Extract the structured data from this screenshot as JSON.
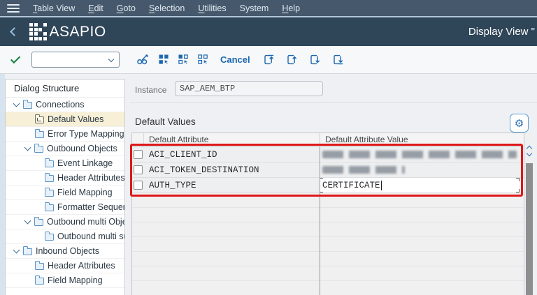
{
  "menu_bar": {
    "items": [
      {
        "label": "Table View",
        "accel": "T"
      },
      {
        "label": "Edit",
        "accel": "E"
      },
      {
        "label": "Goto",
        "accel": "G"
      },
      {
        "label": "Selection",
        "accel": "S"
      },
      {
        "label": "Utilities",
        "accel": "U"
      },
      {
        "label": "System",
        "accel": null
      },
      {
        "label": "Help",
        "accel": "H"
      }
    ]
  },
  "title_bar": {
    "logo_text": "ASAPIO",
    "window_title": "Display View \""
  },
  "toolbar": {
    "command_field_value": "",
    "cancel_label": "Cancel",
    "icon_names": [
      "enter-check-icon",
      "command-combobox",
      "display-change-icon",
      "select-all-icon",
      "select-block-icon",
      "deselect-all-icon",
      "first-page-icon",
      "previous-page-icon",
      "next-page-icon",
      "last-page-icon"
    ]
  },
  "sidebar": {
    "header": "Dialog Structure",
    "items": [
      {
        "label": "Connections",
        "indent": 10,
        "chevron": true,
        "icon": "folder-open",
        "selected": false
      },
      {
        "label": "Default Values",
        "indent": 42,
        "chevron": false,
        "icon": "folder-display",
        "selected": true
      },
      {
        "label": "Error Type Mapping",
        "indent": 42,
        "chevron": false,
        "icon": "folder",
        "selected": false
      },
      {
        "label": "Outbound Objects",
        "indent": 26,
        "chevron": true,
        "icon": "folder-open",
        "selected": false
      },
      {
        "label": "Event Linkage",
        "indent": 56,
        "chevron": false,
        "icon": "folder",
        "selected": false
      },
      {
        "label": "Header Attributes",
        "indent": 56,
        "chevron": false,
        "icon": "folder",
        "selected": false
      },
      {
        "label": "Field Mapping",
        "indent": 56,
        "chevron": false,
        "icon": "folder",
        "selected": false
      },
      {
        "label": "Formatter Sequence",
        "indent": 56,
        "chevron": false,
        "icon": "folder",
        "selected": false
      },
      {
        "label": "Outbound multi Objects",
        "indent": 26,
        "chevron": true,
        "icon": "folder-open",
        "selected": false
      },
      {
        "label": "Outbound multi sub O",
        "indent": 56,
        "chevron": false,
        "icon": "folder",
        "selected": false
      },
      {
        "label": "Inbound Objects",
        "indent": 10,
        "chevron": true,
        "icon": "folder-open",
        "selected": false
      },
      {
        "label": "Header Attributes",
        "indent": 42,
        "chevron": false,
        "icon": "folder",
        "selected": false
      },
      {
        "label": "Field Mapping",
        "indent": 42,
        "chevron": false,
        "icon": "folder",
        "selected": false
      }
    ]
  },
  "main": {
    "instance": {
      "label": "Instance",
      "value": "SAP_AEM_BTP"
    },
    "section_title": "Default Values",
    "table": {
      "columns": [
        "Default Attribute",
        "Default Attribute Value"
      ],
      "rows": [
        {
          "attribute": "ACI_CLIENT_ID",
          "value": "",
          "redacted": true,
          "redacted_width": 278,
          "focused": false
        },
        {
          "attribute": "ACI_TOKEN_DESTINATION",
          "value": "",
          "redacted": true,
          "redacted_width": 118,
          "focused": false
        },
        {
          "attribute": "AUTH_TYPE",
          "value": "CERTIFICATE",
          "redacted": false,
          "focused": true
        }
      ],
      "empty_row_count": 7
    }
  },
  "annotation": {
    "highlight_color": "#e01717"
  },
  "colors": {
    "menu_bar_bg": "#45586c",
    "title_bar_bg": "#2f4558",
    "selected_tree_item_bg": "#f7efd6",
    "link_blue": "#1a66b0",
    "check_green": "#107e3e"
  }
}
